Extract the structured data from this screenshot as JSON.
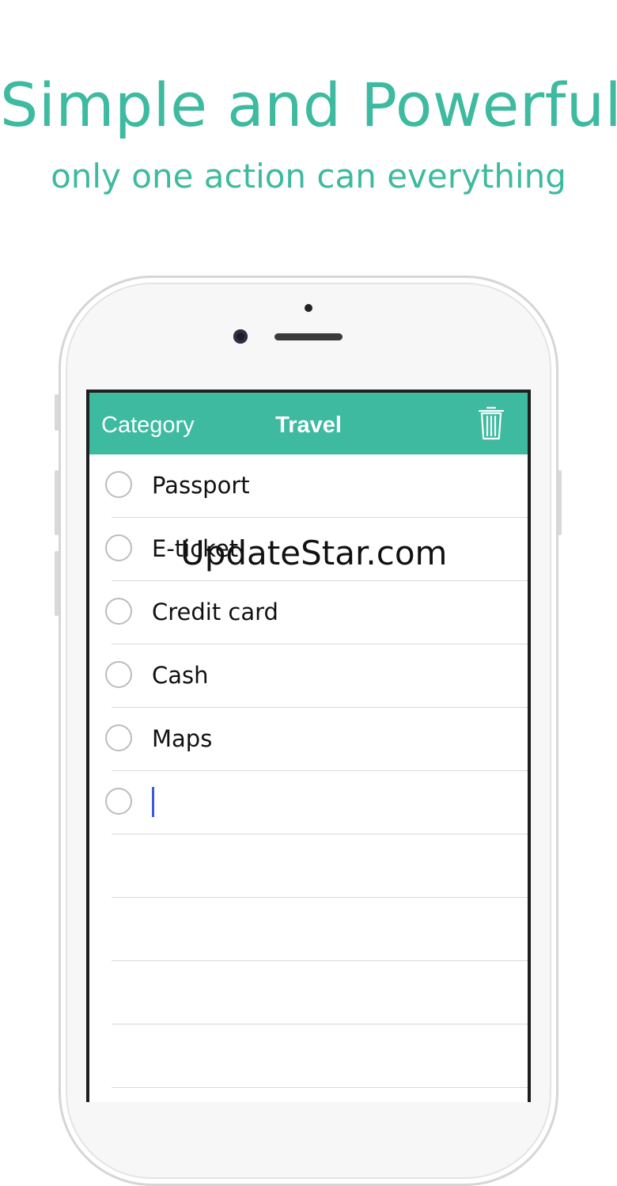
{
  "headline": "Simple and Powerful",
  "subheadline": "only one action can everything",
  "navbar": {
    "left_label": "Category",
    "title": "Travel",
    "right_icon": "trash-icon"
  },
  "items": [
    {
      "label": "Passport",
      "checked": false
    },
    {
      "label": "E-ticket",
      "checked": false
    },
    {
      "label": "Credit card",
      "checked": false
    },
    {
      "label": "Cash",
      "checked": false
    },
    {
      "label": "Maps",
      "checked": false
    },
    {
      "label": "",
      "checked": false,
      "editing": true
    }
  ],
  "watermark": "UpdateStar.com",
  "colors": {
    "accent": "#3dba9f",
    "caret": "#3b5bdb"
  }
}
